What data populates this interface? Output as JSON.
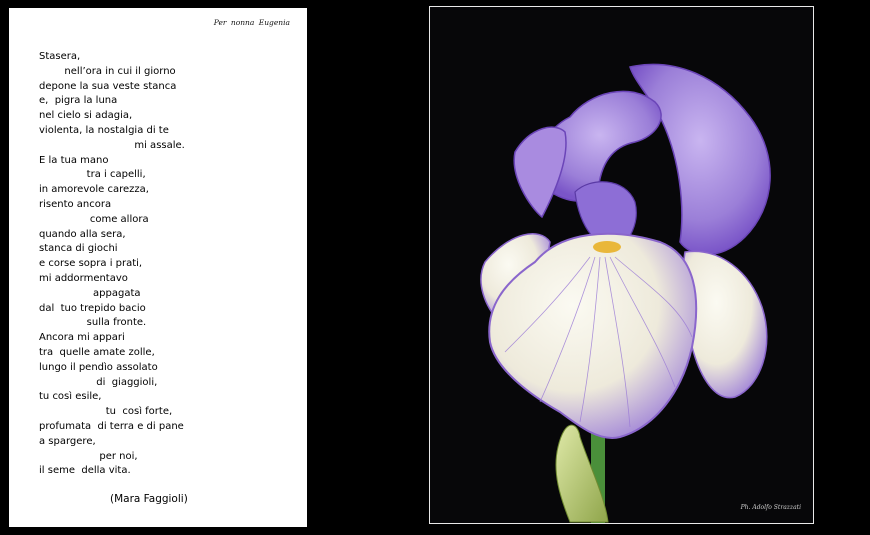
{
  "poem_page": {
    "dedication": "Per nonna Eugenia",
    "lines": [
      "Stasera,",
      "        nell’ora in cui il giorno",
      "depone la sua veste stanca",
      "e,  pigra la luna",
      "nel cielo si adagia,",
      "violenta, la nostalgia di te",
      "                              mi assale.",
      "E la tua mano",
      "               tra i capelli,",
      "in amorevole carezza,",
      "risento ancora",
      "                come allora",
      "quando alla sera,",
      "stanca di giochi",
      "e corse sopra i prati,",
      "mi addormentavo",
      "                 appagata",
      "dal  tuo trepido bacio",
      "               sulla fronte.",
      "Ancora mi appari",
      "tra  quelle amate zolle,",
      "lungo il pendìo assolato",
      "                  di  giaggioli,",
      "tu così esile,",
      "                     tu  così forte,",
      "profumata  di terra e di pane",
      "a spargere,",
      "                   per noi,",
      "il seme  della vita."
    ],
    "author": "(Mara Faggioli)"
  },
  "photo": {
    "subject": "iris flower",
    "credit": "Ph. Adolfo Strazzati",
    "colors": {
      "background": "#070709",
      "petal_violet": "#9b7fd8",
      "petal_white": "#f1efe6",
      "stem": "#4a8f3a",
      "beard": "#e9b73a"
    }
  }
}
